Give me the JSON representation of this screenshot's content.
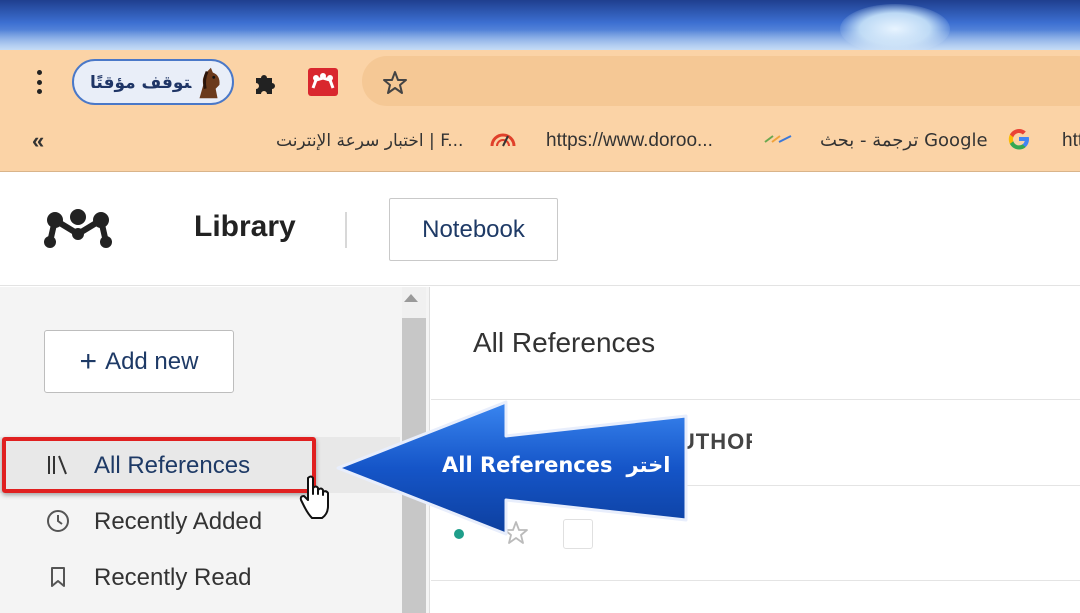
{
  "browser": {
    "profile_label": "متوقف مؤقتًا",
    "bookmarks": {
      "overflow_chevron": "«",
      "speed_test": "اختبار سرعة الإنترنت | F...",
      "doroo": "https://www.doroo...",
      "google_translate": "ترجمة - بحث Google",
      "more": "htt"
    }
  },
  "app": {
    "library_title": "Library",
    "notebook_button": "Notebook"
  },
  "sidebar": {
    "add_new": "Add new",
    "items": [
      {
        "label": "All References",
        "icon": "library-icon",
        "selected": true
      },
      {
        "label": "Recently Added",
        "icon": "clock-icon"
      },
      {
        "label": "Recently Read",
        "icon": "bookmark-icon"
      }
    ]
  },
  "main": {
    "title": "All References",
    "column_header": "AUTHORS"
  },
  "callout": {
    "text_en": "All References",
    "text_ar": "اختر"
  },
  "colors": {
    "browser_chrome": "#fbd3a6",
    "accent_navy": "#1e3a66",
    "highlight_red": "#e02020",
    "callout_blue": "#1555c8",
    "unread_dot": "#1f9e8a"
  }
}
